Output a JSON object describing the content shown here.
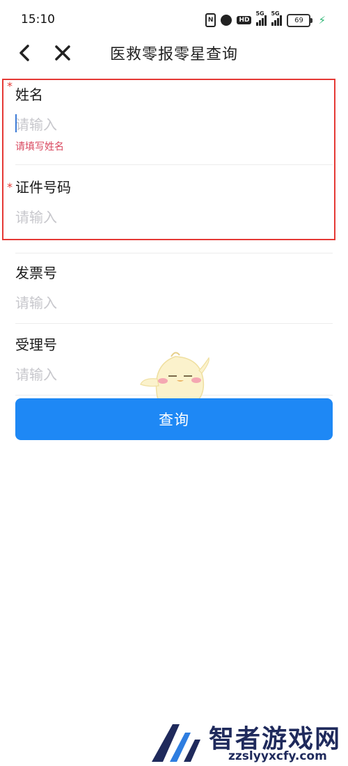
{
  "status_bar": {
    "time": "15:10",
    "nfc_label": "N",
    "hd_label": "HD",
    "signal_tag_1": "5G",
    "signal_tag_2": "5G",
    "battery_level": "69",
    "charging_icon": "bolt-icon"
  },
  "nav": {
    "title": "医救零报零星查询",
    "back_icon": "chevron-left-icon",
    "close_icon": "close-icon"
  },
  "form": {
    "required_mark": "*",
    "fields": [
      {
        "label": "姓名",
        "placeholder": "请输入",
        "value": "",
        "required": true,
        "error": "请填写姓名"
      },
      {
        "label": "证件号码",
        "placeholder": "请输入",
        "value": "",
        "required": true
      },
      {
        "label": "发票号",
        "placeholder": "请输入",
        "value": "",
        "required": false
      },
      {
        "label": "受理号",
        "placeholder": "请输入",
        "value": "",
        "required": false
      }
    ],
    "submit_label": "查询"
  },
  "watermark": {
    "title": "智者游戏网",
    "url": "zzslyyxcfy.com"
  },
  "colors": {
    "accent": "#1e88f5",
    "error": "#e53935",
    "error_text": "#d9485f",
    "placeholder": "#c7c7cc"
  }
}
